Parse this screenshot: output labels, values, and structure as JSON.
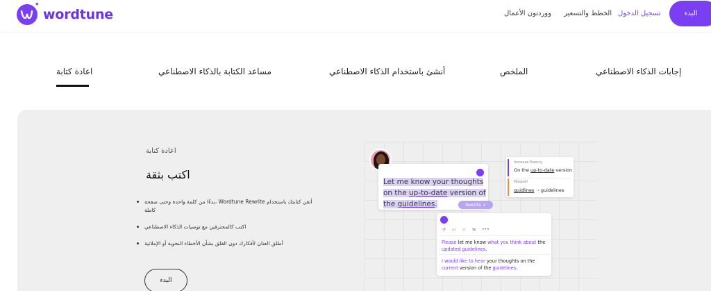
{
  "header": {
    "logo_text": "wordtune",
    "nav": {
      "business": "ووردتون الأعمال",
      "pricing": "الخطط والتسعير",
      "login": "تسجيل الدخول",
      "start": "البدء"
    }
  },
  "tabs": [
    {
      "label": "إجابات الذكاء الاصطناعي"
    },
    {
      "label": "الملخص"
    },
    {
      "label": "أنشئ باستخدام الذكاء الاصطناعي"
    },
    {
      "label": "مساعد الكتابة بالذكاء الاصطناعي"
    },
    {
      "label": "اعادة كتابة",
      "active": true
    }
  ],
  "feature": {
    "eyebrow": "اعادة كتابة",
    "title": "اكتب بثقة",
    "bullets": [
      "بدءًا من كلمة واحدة وحتى صفحة، Wordtune Rewrite أتقن كتابتك باستخدام كاملة",
      "اكتب كالمحترفين مع توصيات الذكاء الاصطناعي",
      "أطلق العنان لأفكارك دون القلق بشأن الأخطاء النحوية أو الإملائية"
    ],
    "cta": "البدء"
  },
  "illustration": {
    "message": {
      "before": "Let me know your thoughts on the ",
      "link": "up-to-date",
      "middle": " version of the ",
      "link2": "guidelines",
      "after": "."
    },
    "rewrite_pill": "Rewrite ↗",
    "suggestions": {
      "s1_label": "Increase fluency",
      "s1_before": "On the ",
      "s1_link": "up-to-date",
      "s1_after": " version",
      "s2_label": "Misspell",
      "s2_wrong": "guidlines",
      "s2_arrow": "→",
      "s2_right": "guidelines"
    },
    "rewrites": {
      "toolbar": [
        "↺",
        "▭",
        "☆",
        "⇆",
        "•••"
      ],
      "r1": {
        "a": "Please",
        "b": " let me know ",
        "c": "what you think about",
        "d": " the ",
        "e": "updated guidelines",
        "f": "."
      },
      "r2": {
        "a": "I would like to hear",
        "b": " your thoughts on the ",
        "c": "current",
        "d": " version of the ",
        "e": "guidelines",
        "f": "."
      }
    }
  },
  "colors": {
    "brand": "#7a3ff2",
    "panel_bg": "#efefef"
  }
}
